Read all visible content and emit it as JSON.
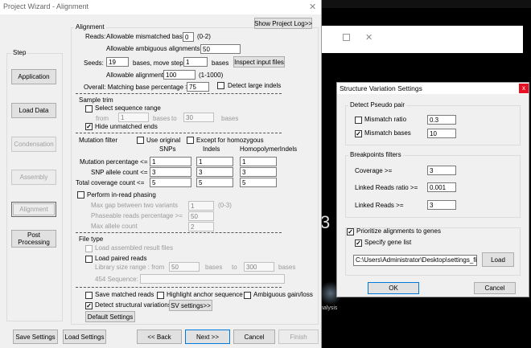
{
  "main": {
    "title": "Project Wizard - Alignment",
    "show_log": "Show Project Log>>",
    "step": {
      "legend": "Step",
      "items": [
        "Application",
        "Load Data",
        "Condensation",
        "Assembly",
        "Alignment",
        "Post Processing"
      ]
    },
    "alignment": {
      "legend": "Alignment",
      "reads_label": "Reads:",
      "mismatched_label": "Allowable mismatched bases",
      "mismatched_value": "0",
      "mismatched_range": "(0-2)",
      "ambiguous_label": "Allowable ambiguous alignments",
      "ambiguous_value": "50",
      "seeds_label": "Seeds:",
      "seeds_value": "19",
      "bases_move_step": "bases,  move step",
      "move_step_value": "1",
      "bases": "bases",
      "inspect": "Inspect input files",
      "allowable_alignments": "Allowable alignments",
      "allowable_value": "100",
      "allowable_range": "(1-1000)",
      "overall_label": "Overall:  Matching base percentage >=",
      "overall_value": "75",
      "large_indels": "Detect large indels"
    },
    "trim": {
      "legend": "Sample trim",
      "select_range": "Select sequence range",
      "from": "from",
      "from_value": "1",
      "bases": "bases",
      "to": "to",
      "to_value": "30",
      "bases2": "bases",
      "hide_unmatched": "Hide unmatched ends"
    },
    "mutation": {
      "legend": "Mutation filter",
      "use_original": "Use original",
      "except_homo": "Except for homozygous",
      "col_snps": "SNPs",
      "col_indels": "Indels",
      "col_homo": "HomopolymerIndels",
      "rows": [
        {
          "label": "Mutation percentage <=",
          "v1": "1",
          "v2": "1",
          "v3": "1"
        },
        {
          "label": "SNP allele count <=",
          "v1": "3",
          "v2": "3",
          "v3": "3"
        },
        {
          "label": "Total coverage count <=",
          "v1": "5",
          "v2": "5",
          "v3": "5"
        }
      ],
      "inread": "Perform in-read phasing",
      "max_gap": "Max gap between two variants",
      "max_gap_value": "1",
      "max_gap_range": "(0-3)",
      "phaseable": "Phaseable reads percentage >=",
      "phaseable_value": "50",
      "max_allele": "Max allele count",
      "max_allele_value": "2"
    },
    "filetype": {
      "legend": "File type",
      "load_assembled": "Load assembled result files",
      "load_paired": "Load paired reads",
      "lib_range": "Library size range :  from",
      "lib_from": "50",
      "bases": "bases",
      "to": "to",
      "lib_to": "300",
      "bases2": "bases",
      "seq454": "454 Sequence:"
    },
    "bottom_opts": {
      "save_matched": "Save matched reads",
      "highlight_anchor": "Highlight anchor sequence",
      "ambiguous_gain": "Ambiguous gain/loss",
      "detect_sv": "Detect structural variations",
      "sv_settings": "SV settings>>",
      "default_settings": "Default Settings"
    },
    "footer": {
      "save": "Save Settings",
      "load": "Load Settings",
      "back": "<< Back",
      "next": "Next >>",
      "cancel": "Cancel",
      "finish": "Finish"
    }
  },
  "bg_window": {
    "digit": "3",
    "tagline": "nalysis"
  },
  "sv": {
    "title": "Structure Variation Settings",
    "pseudo_legend": "Detect Pseudo pair",
    "mismatch_ratio": "Mismatch ratio",
    "mismatch_ratio_value": "0.3",
    "mismatch_bases": "Mismatch bases",
    "mismatch_bases_value": "10",
    "bp_legend": "Breakpoints filters",
    "coverage": "Coverage >=",
    "coverage_value": "3",
    "linked_ratio": "Linked Reads ratio >=",
    "linked_ratio_value": "0.001",
    "linked_reads": "Linked Reads >=",
    "linked_reads_value": "3",
    "prioritize": "Prioritize alignments to genes",
    "specify_gene": "Specify gene list",
    "gene_path": "C:\\Users\\Administrator\\Desktop\\settings_files\\g",
    "load": "Load",
    "ok": "OK",
    "cancel": "Cancel",
    "close_glyph": "x"
  }
}
